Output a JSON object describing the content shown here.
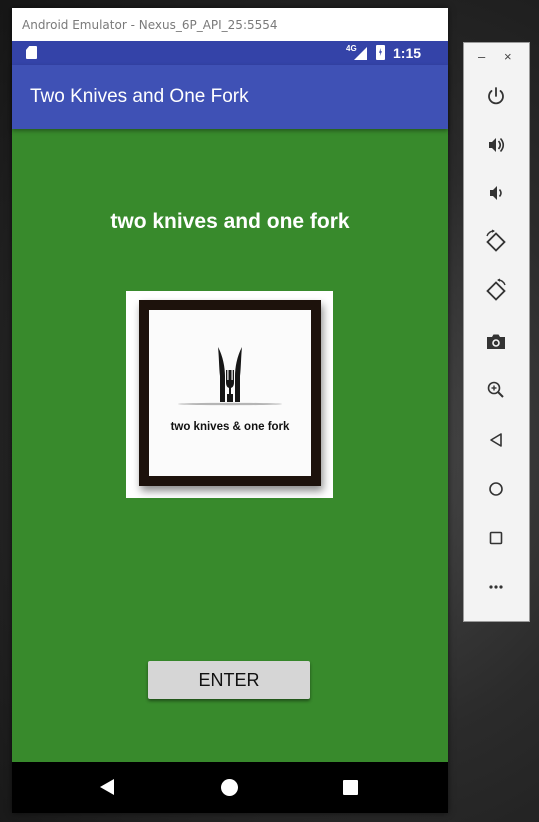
{
  "emulator": {
    "title": "Android Emulator - Nexus_6P_API_25:5554"
  },
  "status_bar": {
    "network": "4G",
    "time": "1:15",
    "icons": [
      "sd-card-icon",
      "signal-icon",
      "battery-charging-icon"
    ]
  },
  "app": {
    "toolbar_title": "Two Knives and One Fork",
    "headline": "two knives and one fork",
    "logo_text": "two knives & one fork",
    "enter_label": "ENTER"
  },
  "nav_bar": {
    "icons": [
      "back-icon",
      "home-icon",
      "recents-icon"
    ]
  },
  "side_toolbar": {
    "minimize_label": "–",
    "close_label": "×",
    "buttons": [
      "power",
      "volume-up",
      "volume-down",
      "rotate-left",
      "rotate-right",
      "camera",
      "zoom",
      "back",
      "home",
      "overview",
      "more"
    ]
  },
  "colors": {
    "status_bar": "#3443a8",
    "app_bar": "#3f51b5",
    "content_background": "#388a2c",
    "button_background": "#d6d6d6"
  }
}
